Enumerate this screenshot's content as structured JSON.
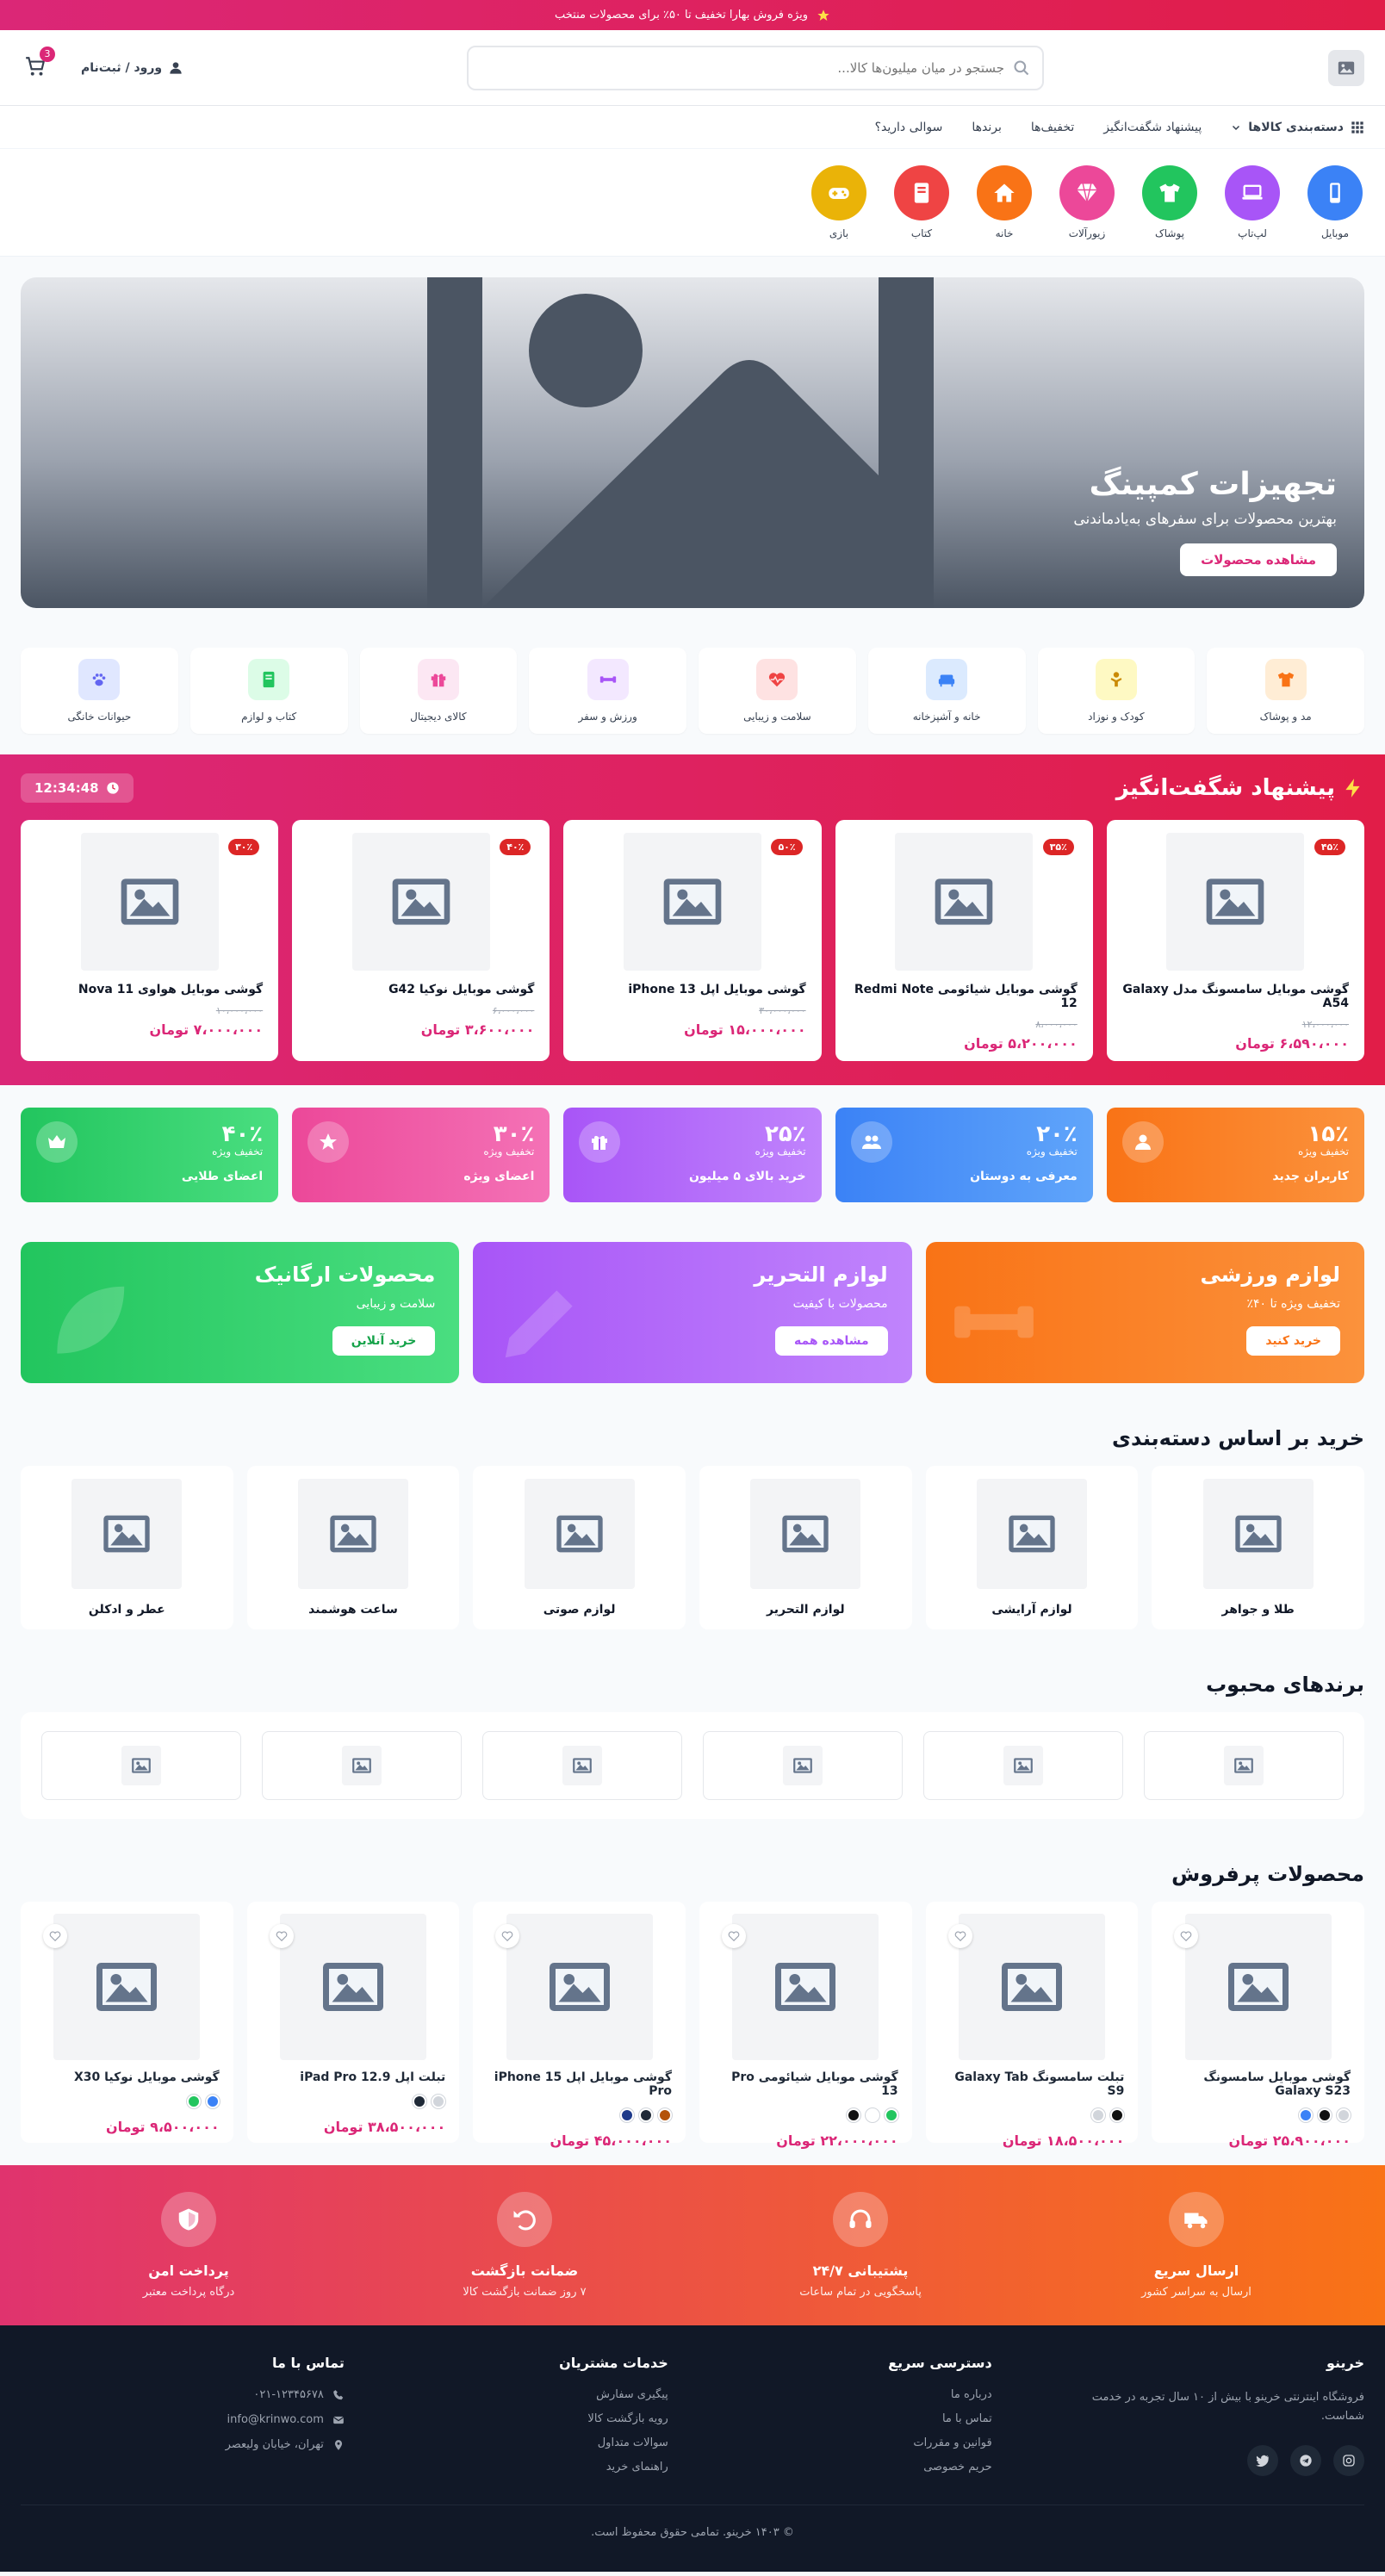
{
  "colors": {
    "accent": "#db2777",
    "dark": "#111827"
  },
  "announcement": {
    "text": "ویژه فروش بهارا تخفیف تا ۵۰٪ برای محصولات منتخب",
    "icon": "star-icon"
  },
  "header": {
    "search_placeholder": "جستجو در میان میلیون‌ها کالا...",
    "login": "ورود / ثبت‌نام",
    "cart_count": "3"
  },
  "nav": {
    "categories": "دسته‌بندی کالاها",
    "items": [
      "پیشنهاد شگفت‌انگیز",
      "تخفیف‌ها",
      "برندها",
      "سوالی دارید؟"
    ]
  },
  "stories": [
    {
      "label": "موبایل",
      "color": "#3b82f6",
      "icon": "mobile-icon"
    },
    {
      "label": "لپ‌تاپ",
      "color": "#a855f7",
      "icon": "laptop-icon"
    },
    {
      "label": "پوشاک",
      "color": "#22c55e",
      "icon": "shirt-icon"
    },
    {
      "label": "زیورآلات",
      "color": "#ec4899",
      "icon": "gem-icon"
    },
    {
      "label": "خانه",
      "color": "#f97316",
      "icon": "home-icon"
    },
    {
      "label": "کتاب",
      "color": "#ef4444",
      "icon": "book-icon"
    },
    {
      "label": "بازی",
      "color": "#eab308",
      "icon": "gamepad-icon"
    }
  ],
  "hero": {
    "title": "تجهیزات کمپینگ",
    "subtitle": "بهترین محصولات برای سفرهای به‌یادماندنی",
    "cta": "مشاهده محصولات"
  },
  "tiles": [
    {
      "label": "مد و پوشاک",
      "bg": "#ffedd5",
      "fg": "#f97316",
      "icon": "shirt-icon"
    },
    {
      "label": "کودک و نوزاد",
      "bg": "#fef9c3",
      "fg": "#ca8a04",
      "icon": "baby-icon"
    },
    {
      "label": "خانه و آشپزخانه",
      "bg": "#dbeafe",
      "fg": "#3b82f6",
      "icon": "couch-icon"
    },
    {
      "label": "سلامت و زیبایی",
      "bg": "#fee2e2",
      "fg": "#ef4444",
      "icon": "heartbeat-icon"
    },
    {
      "label": "ورزش و سفر",
      "bg": "#f3e8ff",
      "fg": "#a855f7",
      "icon": "dumbbell-icon"
    },
    {
      "label": "کالای دیجیتال",
      "bg": "#fce7f3",
      "fg": "#ec4899",
      "icon": "gift-icon"
    },
    {
      "label": "کتاب و لوازم",
      "bg": "#dcfce7",
      "fg": "#22c55e",
      "icon": "book-icon"
    },
    {
      "label": "حیوانات خانگی",
      "bg": "#e0e7ff",
      "fg": "#6366f1",
      "icon": "paw-icon"
    }
  ],
  "flash": {
    "title": "پیشنهاد شگفت‌انگیز",
    "timer": "12:34:48",
    "products": [
      {
        "name": "گوشی موبایل سامسونگ مدل Galaxy A54",
        "old": "۱۲،۰۰۰،۰۰۰",
        "price": "۶،۵۹۰،۰۰۰ تومان",
        "off": "۴۵٪"
      },
      {
        "name": "گوشی موبایل شیائومی Redmi Note 12",
        "old": "۸،۰۰۰،۰۰۰",
        "price": "۵،۲۰۰،۰۰۰ تومان",
        "off": "۳۵٪"
      },
      {
        "name": "گوشی موبایل اپل iPhone 13",
        "old": "۳۰،۰۰۰،۰۰۰",
        "price": "۱۵،۰۰۰،۰۰۰ تومان",
        "off": "۵۰٪"
      },
      {
        "name": "گوشی موبایل نوکیا G42",
        "old": "۶،۰۰۰،۰۰۰",
        "price": "۳،۶۰۰،۰۰۰ تومان",
        "off": "۴۰٪"
      },
      {
        "name": "گوشی موبایل هواوی Nova 11",
        "old": "۱۰،۰۰۰،۰۰۰",
        "price": "۷،۰۰۰،۰۰۰ تومان",
        "off": "۳۰٪"
      }
    ]
  },
  "coupons": [
    {
      "value": "۱۵٪",
      "label": "تخفیف ویژه",
      "desc": "کاربران جدید",
      "from": "#f97316",
      "to": "#fb923c",
      "icon": "user-icon"
    },
    {
      "value": "۲۰٪",
      "label": "تخفیف ویژه",
      "desc": "معرفی به دوستان",
      "from": "#3b82f6",
      "to": "#60a5fa",
      "icon": "users-icon"
    },
    {
      "value": "۲۵٪",
      "label": "تخفیف ویژه",
      "desc": "خرید بالای ۵ میلیون",
      "from": "#a855f7",
      "to": "#c084fc",
      "icon": "gift-icon"
    },
    {
      "value": "۳۰٪",
      "label": "تخفیف ویژه",
      "desc": "اعضای ویژه",
      "from": "#ec4899",
      "to": "#f472b6",
      "icon": "star-icon"
    },
    {
      "value": "۴۰٪",
      "label": "تخفیف ویژه",
      "desc": "اعضای طلایی",
      "from": "#22c55e",
      "to": "#4ade80",
      "icon": "crown-icon"
    }
  ],
  "promos": [
    {
      "title": "لوازم ورزشی",
      "sub": "تخفیف ویژه تا ۴۰٪",
      "cta": "خرید کنید",
      "from": "#f97316",
      "to": "#fb923c",
      "btn": "#f97316",
      "icon": "dumbbell-icon"
    },
    {
      "title": "لوازم التحریر",
      "sub": "محصولات با کیفیت",
      "cta": "مشاهده همه",
      "from": "#a855f7",
      "to": "#c084fc",
      "btn": "#a855f7",
      "icon": "pencil-icon"
    },
    {
      "title": "محصولات ارگانیک",
      "sub": "سلامت و زیبایی",
      "cta": "خرید آنلاین",
      "from": "#22c55e",
      "to": "#4ade80",
      "btn": "#16a34a",
      "icon": "leaf-icon"
    }
  ],
  "shop_cats": {
    "title": "خرید بر اساس دسته‌بندی",
    "items": [
      "طلا و جواهر",
      "لوازم آرایشی",
      "لوازم التحریر",
      "لوازم صوتی",
      "ساعت هوشمند",
      "عطر و ادکلن"
    ]
  },
  "brands": {
    "title": "برندهای محبوب",
    "count": 6
  },
  "best": {
    "title": "محصولات پرفروش",
    "products": [
      {
        "name": "گوشی موبایل سامسونگ Galaxy S23",
        "price": "۲۵،۹۰۰،۰۰۰ تومان",
        "swatches": [
          "#d1d5db",
          "#111111",
          "#3b82f6"
        ]
      },
      {
        "name": "تبلت سامسونگ Galaxy Tab S9",
        "price": "۱۸،۵۰۰،۰۰۰ تومان",
        "swatches": [
          "#111111",
          "#d1d5db"
        ]
      },
      {
        "name": "گوشی موبایل شیائومی Pro 13",
        "price": "۲۲،۰۰۰،۰۰۰ تومان",
        "swatches": [
          "#22c55e",
          "#ffffff",
          "#111111"
        ]
      },
      {
        "name": "گوشی موبایل اپل iPhone 15 Pro",
        "price": "۴۵،۰۰۰،۰۰۰ تومان",
        "swatches": [
          "#b45309",
          "#1f2937",
          "#1e3a8a"
        ]
      },
      {
        "name": "تبلت اپل iPad Pro 12.9",
        "price": "۳۸،۵۰۰،۰۰۰ تومان",
        "swatches": [
          "#d1d5db",
          "#1f2937"
        ]
      },
      {
        "name": "گوشی موبایل نوکیا X30",
        "price": "۹،۵۰۰،۰۰۰ تومان",
        "swatches": [
          "#3b82f6",
          "#22c55e"
        ]
      }
    ]
  },
  "features": [
    {
      "title": "ارسال سریع",
      "sub": "ارسال به سراسر کشور",
      "icon": "truck-icon"
    },
    {
      "title": "پشتیبانی ۲۴/۷",
      "sub": "پاسخگویی در تمام ساعات",
      "icon": "headset-icon"
    },
    {
      "title": "ضمانت بازگشت",
      "sub": "۷ روز ضمانت بازگشت کالا",
      "icon": "undo-icon"
    },
    {
      "title": "پرداخت امن",
      "sub": "درگاه پرداخت معتبر",
      "icon": "shield-icon"
    }
  ],
  "footer": {
    "brand": "خرینو",
    "about": "فروشگاه اینترنتی خرینو با بیش از ۱۰ سال تجربه در خدمت شماست.",
    "quick": {
      "title": "دسترسی سریع",
      "links": [
        "درباره ما",
        "تماس با ما",
        "قوانین و مقررات",
        "حریم خصوصی"
      ]
    },
    "service": {
      "title": "خدمات مشتریان",
      "links": [
        "پیگیری سفارش",
        "رویه بازگشت کالا",
        "سوالات متداول",
        "راهنمای خرید"
      ]
    },
    "contact": {
      "title": "تماس با ما",
      "phone": "۰۲۱-۱۲۳۴۵۶۷۸",
      "email": "info@krinwo.com",
      "address": "تهران، خیابان ولیعصر"
    },
    "copyright": "© ۱۴۰۳ خرینو. تمامی حقوق محفوظ است."
  }
}
